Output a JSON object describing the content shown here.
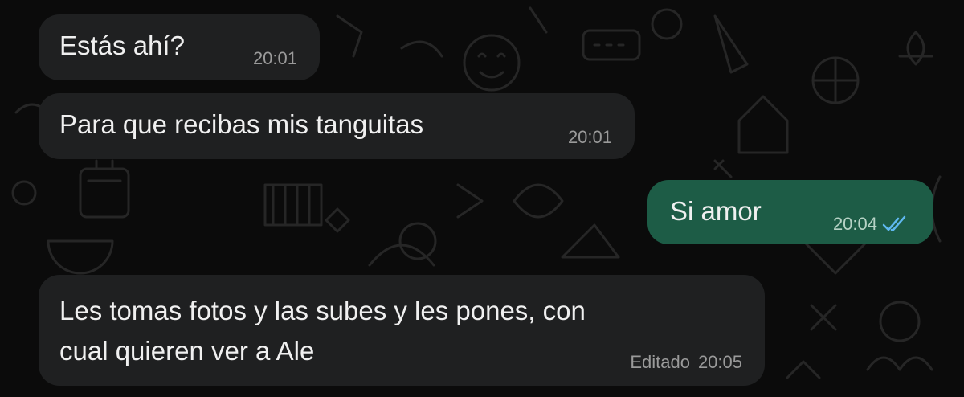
{
  "theme": {
    "background": "#0b0b0b",
    "incoming_bubble": "#1f2021",
    "outgoing_bubble": "#1d5c46",
    "read_tick_color": "#5fb8f0"
  },
  "messages": [
    {
      "direction": "incoming",
      "text": "Estás ahí?",
      "time": "20:01"
    },
    {
      "direction": "incoming",
      "text": "Para que recibas mis tanguitas",
      "time": "20:01"
    },
    {
      "direction": "outgoing",
      "text": "Si amor",
      "time": "20:04",
      "status_icon": "double-check-read-icon"
    },
    {
      "direction": "incoming",
      "text": "Les tomas fotos y las subes y les pones, con\ncual quieren ver a Ale",
      "edited_label": "Editado",
      "time": "20:05"
    }
  ]
}
